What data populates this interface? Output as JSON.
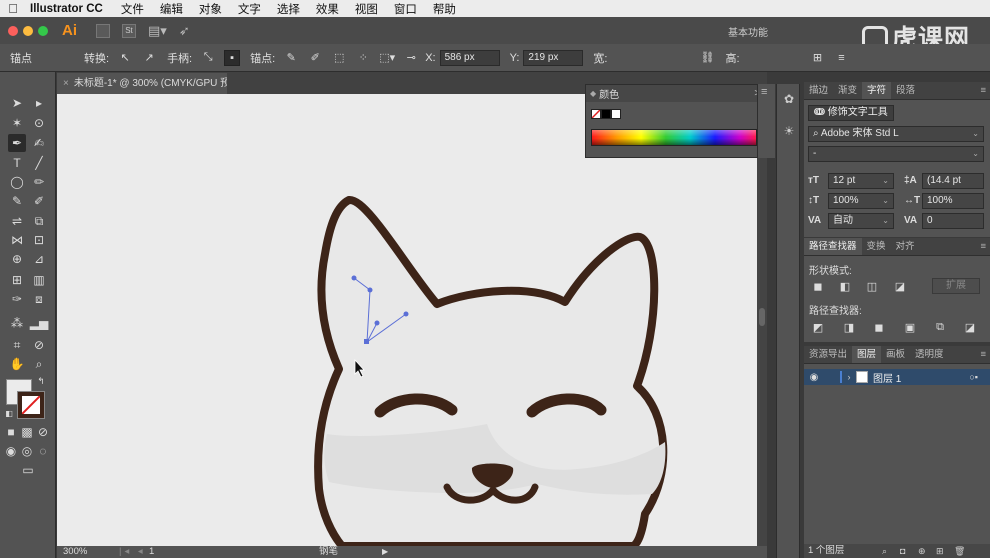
{
  "menubar": {
    "app_name": "Illustrator CC",
    "items": [
      "文件",
      "编辑",
      "对象",
      "文字",
      "选择",
      "效果",
      "视图",
      "窗口",
      "帮助"
    ]
  },
  "appbar": {
    "logo": "Ai",
    "workspace": "基本功能",
    "watermark": "虎课网"
  },
  "controlbar": {
    "anchor_label": "锚点",
    "convert_label": "转换:",
    "handle_label": "手柄:",
    "anchors_label": "锚点:",
    "x_label": "X:",
    "x_value": "586 px",
    "y_label": "Y:",
    "y_value": "219 px",
    "width_label": "宽:",
    "height_label": "高:"
  },
  "document": {
    "tab_title": "未标题-1* @ 300% (CMYK/GPU 预览)",
    "tab_close": "×"
  },
  "status": {
    "zoom": "300%",
    "page": "1",
    "tool": "钢笔",
    "nav_arrows": "|◂ ◂",
    "play_arrow": "▶"
  },
  "color_panel": {
    "title": "颜色",
    "collapse": ">>",
    "menu": "≡"
  },
  "char_panel": {
    "tabs": [
      "描边",
      "渐变",
      "字符",
      "段落"
    ],
    "active_tab": "字符",
    "touch_tool": "修饰文字工具",
    "font_family": "Adobe 宋体 Std L",
    "font_style": "-",
    "font_size": "12 pt",
    "leading": "(14.4 pt",
    "vscale": "100%",
    "hscale": "100%",
    "kerning": "自动",
    "tracking": "0"
  },
  "pathfinder_panel": {
    "tabs": [
      "路径查找器",
      "变换",
      "对齐"
    ],
    "active_tab": "路径查找器",
    "shape_modes_label": "形状模式:",
    "pathfinders_label": "路径查找器:",
    "expand_label": "扩展"
  },
  "layers_panel": {
    "tabs": [
      "资源导出",
      "图层",
      "画板",
      "透明度"
    ],
    "active_tab": "图层",
    "layer_name": "图层 1",
    "footer": "1 个图层"
  },
  "colors": {
    "accent_orange": "#f7931e",
    "outline": "#3d2418",
    "fill_white": "#ececec",
    "fill_grey": "#dcdcdc",
    "path_blue": "#5b6fd6",
    "layer_selected": "#2f4b6b"
  }
}
